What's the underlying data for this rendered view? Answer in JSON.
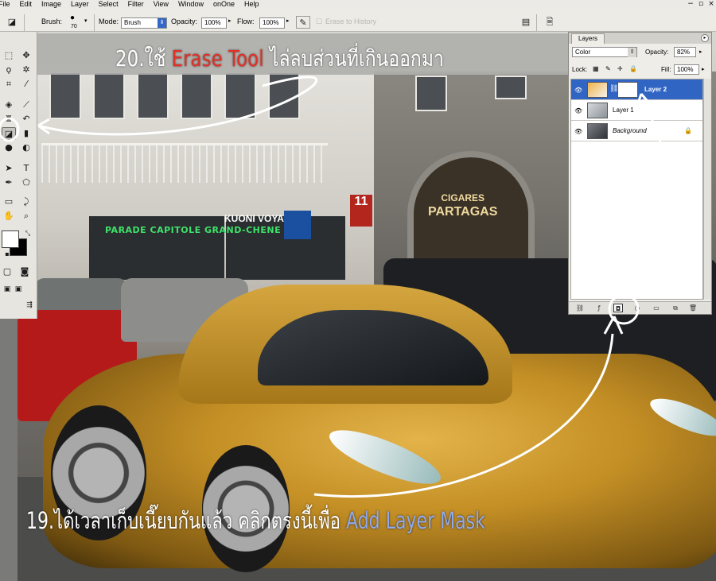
{
  "menubar": {
    "items": [
      "File",
      "Edit",
      "Image",
      "Layer",
      "Select",
      "Filter",
      "View",
      "Window",
      "onOne",
      "Help"
    ]
  },
  "options": {
    "brush_label": "Brush:",
    "brush_size": "70",
    "mode_label": "Mode:",
    "mode_value": "Brush",
    "opacity_label": "Opacity:",
    "opacity_value": "100%",
    "flow_label": "Flow:",
    "flow_value": "100%",
    "erase_history": "Erase to History"
  },
  "layers_panel": {
    "tab": "Layers",
    "blend_mode": "Color",
    "opacity_label": "Opacity:",
    "opacity_value": "82%",
    "lock_label": "Lock:",
    "fill_label": "Fill:",
    "fill_value": "100%",
    "layers": [
      {
        "name": "Layer 2",
        "selected": true,
        "has_mask": true
      },
      {
        "name": "Layer 1",
        "selected": false,
        "has_mask": false
      },
      {
        "name": "Background",
        "selected": false,
        "locked": true
      }
    ]
  },
  "photo": {
    "signs": {
      "green": "PARADE CAPITOLE GRAND-CHENE",
      "kuoni": "KUONI VOYAGE",
      "cigares": "CIGARES",
      "partagas": "PARTAGAS",
      "number": "11"
    }
  },
  "annotations": {
    "step20_prefix": "20.ใช้ ",
    "step20_tool": "Erase Tool",
    "step20_suffix": " ไล่ลบส่วนที่เกินออกมา",
    "step19_prefix": "19.ได้เวลาเก็บเนี๊ยบกันแล้ว คลิกตรงนี้เพื่อ ",
    "step19_action": "Add Layer Mask"
  },
  "colors": {
    "accent_red": "#e03026",
    "accent_blue": "#8fa9ec",
    "selection_blue": "#3065c4",
    "gold": "#c48f25"
  },
  "icons": [
    "eye-icon",
    "link-icon",
    "lock-icon",
    "add-layer-mask-icon",
    "trash-icon",
    "new-layer-icon",
    "folder-icon"
  ]
}
